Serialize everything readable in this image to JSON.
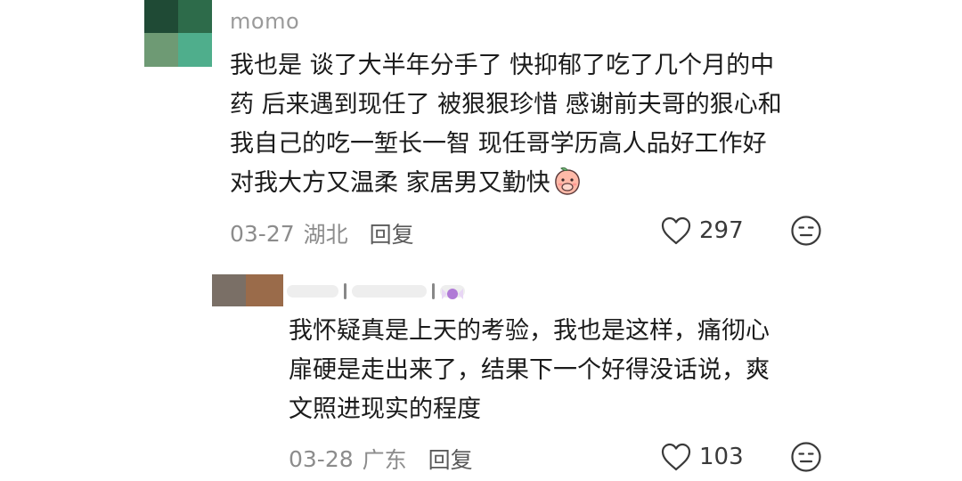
{
  "comment": {
    "username": "momo",
    "lines": [
      "我也是 谈了大半年分手了 快抑郁了吃了几个月的中",
      "药 后来遇到现任了 被狠狠珍惜 感谢前夫哥的狠心和",
      "我自己的吃一堑长一智 现任哥学历高人品好工作好",
      "对我大方又温柔 家居男又勤快"
    ],
    "date": "03-27",
    "region": "湖北",
    "reply_label": "回复",
    "likes": "297",
    "inline_emoji_icon": "peach-covering-mouth-emoji"
  },
  "reply": {
    "lines": [
      "我怀疑真是上天的考验，我也是这样，痛彻心",
      "扉硬是走出来了，结果下一个好得没话说，爽",
      "文照进现实的程度"
    ],
    "date": "03-28",
    "region": "广东",
    "reply_label": "回复",
    "likes": "103"
  },
  "colors": {
    "text": "#1b1b1b",
    "meta": "#8c8c8c",
    "username": "#9a9a9a",
    "avatar": [
      "#1f4a35",
      "#2d6b4a",
      "#6e9a74",
      "#4fae8c"
    ],
    "reply_avatar": [
      "#7a6f66",
      "#9a6b4a"
    ]
  },
  "icons": {
    "like": "heart-outline-icon",
    "reaction": "neutral-face-icon"
  }
}
